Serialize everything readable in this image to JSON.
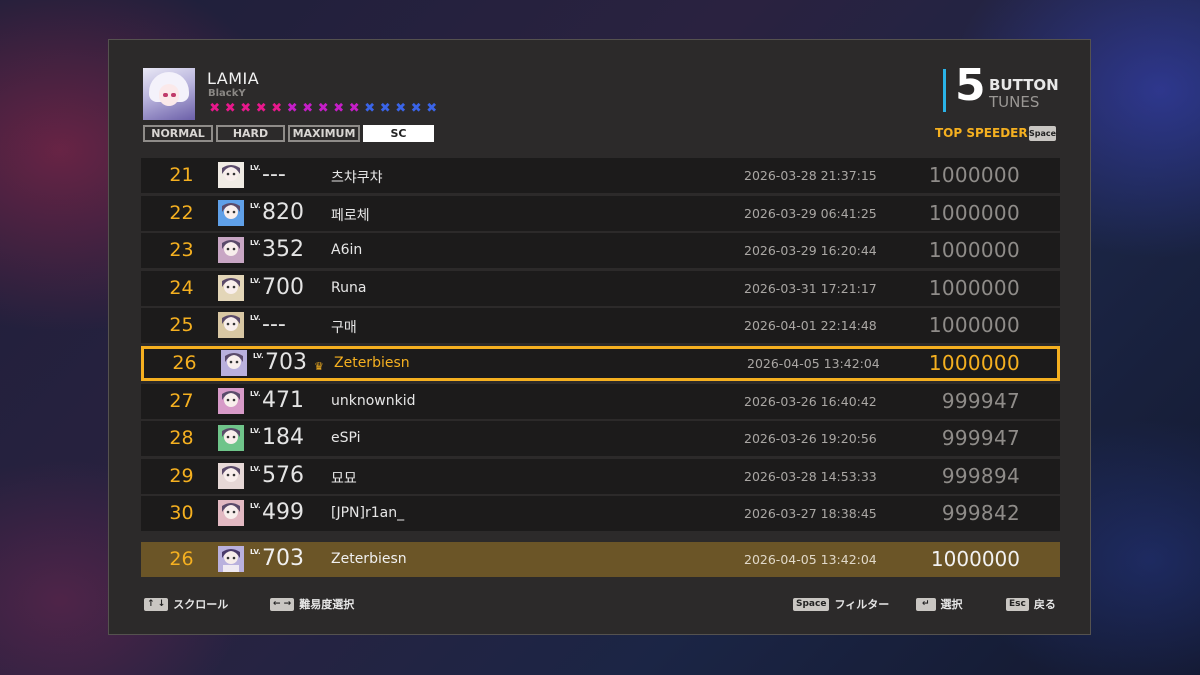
{
  "song": {
    "title": "LAMIA",
    "artist": "BlackY",
    "difficulty_marks": [
      {
        "glyph": "✖",
        "color": "#e8188c"
      },
      {
        "glyph": "✖",
        "color": "#e8188c"
      },
      {
        "glyph": "✖",
        "color": "#e8188c"
      },
      {
        "glyph": "✖",
        "color": "#e8188c"
      },
      {
        "glyph": "✖",
        "color": "#e8188c"
      },
      {
        "glyph": "✖",
        "color": "#c61ec8"
      },
      {
        "glyph": "✖",
        "color": "#c61ec8"
      },
      {
        "glyph": "✖",
        "color": "#c61ec8"
      },
      {
        "glyph": "✖",
        "color": "#c61ec8"
      },
      {
        "glyph": "✖",
        "color": "#c61ec8"
      },
      {
        "glyph": "✖",
        "color": "#3a64e8"
      },
      {
        "glyph": "✖",
        "color": "#3a64e8"
      },
      {
        "glyph": "✖",
        "color": "#3a64e8"
      },
      {
        "glyph": "✖",
        "color": "#3a64e8"
      },
      {
        "glyph": "✖",
        "color": "#3a64e8"
      }
    ]
  },
  "difficulty_tabs": [
    {
      "label": "NORMAL",
      "active": false,
      "width": 70
    },
    {
      "label": "HARD",
      "active": false,
      "width": 69
    },
    {
      "label": "MAXIMUM",
      "active": false,
      "width": 72
    },
    {
      "label": "SC",
      "active": true,
      "width": 71
    }
  ],
  "mode": {
    "number": "5",
    "line1": "BUTTON",
    "line2": "TUNES",
    "accent": "#2ab3e8"
  },
  "filter": {
    "label": "TOP SPEEDER",
    "key": "Space"
  },
  "rankings": [
    {
      "rank": "21",
      "lv": "---",
      "player": "츠챠쿠챠",
      "date": "2026-03-28 21:37:15",
      "score": "1000000",
      "me": false,
      "avatar": "#f0ebe4"
    },
    {
      "rank": "22",
      "lv": "820",
      "player": "페로체",
      "date": "2026-03-29 06:41:25",
      "score": "1000000",
      "me": false,
      "avatar": "#5fa0e8"
    },
    {
      "rank": "23",
      "lv": "352",
      "player": "A6in",
      "date": "2026-03-29 16:20:44",
      "score": "1000000",
      "me": false,
      "avatar": "#c8a6c4"
    },
    {
      "rank": "24",
      "lv": "700",
      "player": "Runa",
      "date": "2026-03-31 17:21:17",
      "score": "1000000",
      "me": false,
      "avatar": "#e3d6b8"
    },
    {
      "rank": "25",
      "lv": "---",
      "player": "구매",
      "date": "2026-04-01 22:14:48",
      "score": "1000000",
      "me": false,
      "avatar": "#d8c7a3"
    },
    {
      "rank": "26",
      "lv": "703",
      "player": "Zeterbiesn",
      "date": "2026-04-05 13:42:04",
      "score": "1000000",
      "me": true,
      "avatar": "#b9b0dd"
    },
    {
      "rank": "27",
      "lv": "471",
      "player": "unknownkid",
      "date": "2026-03-26 16:40:42",
      "score": "999947",
      "me": false,
      "avatar": "#d79ac8"
    },
    {
      "rank": "28",
      "lv": "184",
      "player": "eSPi",
      "date": "2026-03-26 19:20:56",
      "score": "999947",
      "me": false,
      "avatar": "#6fc48a"
    },
    {
      "rank": "29",
      "lv": "576",
      "player": "묘묘",
      "date": "2026-03-28 14:53:33",
      "score": "999894",
      "me": false,
      "avatar": "#e6d8d6"
    },
    {
      "rank": "30",
      "lv": "499",
      "player": "[JPN]r1an_",
      "date": "2026-03-27 18:38:45",
      "score": "999842",
      "me": false,
      "avatar": "#e2b9c2"
    }
  ],
  "my_record": {
    "rank": "26",
    "lv": "703",
    "player": "Zeterbiesn",
    "date": "2026-04-05 13:42:04",
    "score": "1000000"
  },
  "lv_tag": "LV.",
  "crown_icon": "♛",
  "footer": {
    "scroll": {
      "keys": "↑ ↓",
      "label": "スクロール"
    },
    "difficulty": {
      "keys": "← →",
      "label": "難易度選択"
    },
    "filter": {
      "keys": "Space",
      "label": "フィルター"
    },
    "select": {
      "keys": "↵",
      "label": "選択"
    },
    "back": {
      "keys": "Esc",
      "label": "戻る"
    }
  }
}
